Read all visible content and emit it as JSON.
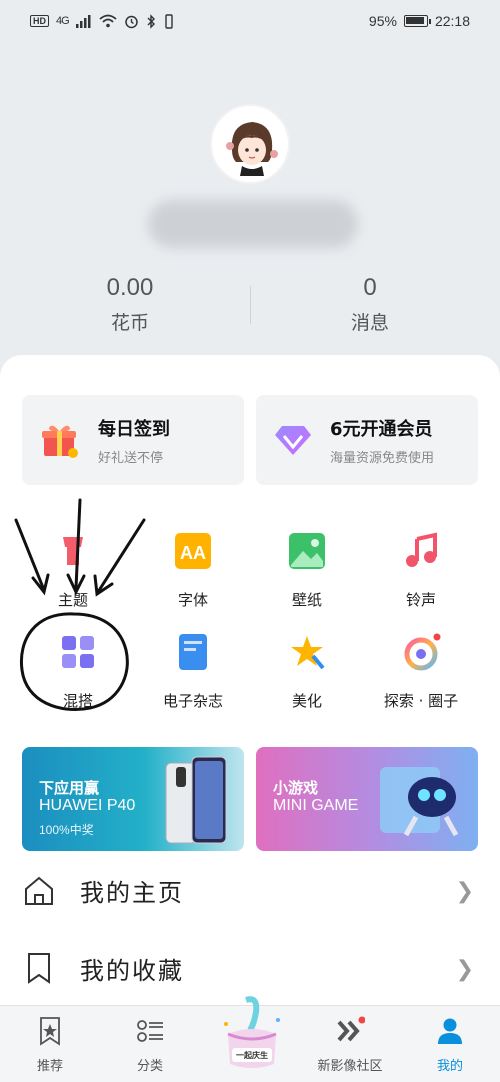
{
  "status_bar": {
    "hd": "HD",
    "network": "4G",
    "battery": "95%",
    "battery_level": 0.95,
    "time": "22:18"
  },
  "profile": {
    "coins_value": "0.00",
    "coins_label": "花币",
    "messages_value": "0",
    "messages_label": "消息"
  },
  "promos": [
    {
      "title": "每日签到",
      "subtitle": "好礼送不停",
      "icon": "gift-icon"
    },
    {
      "title": "6元开通会员",
      "subtitle": "海量资源免费使用",
      "icon": "vip-diamond-icon"
    }
  ],
  "grid": [
    {
      "label": "主题",
      "icon": "theme-icon"
    },
    {
      "label": "字体",
      "icon": "font-icon"
    },
    {
      "label": "壁纸",
      "icon": "wallpaper-icon"
    },
    {
      "label": "铃声",
      "icon": "ringtone-icon"
    },
    {
      "label": "混搭",
      "icon": "mix-icon"
    },
    {
      "label": "电子杂志",
      "icon": "magazine-icon"
    },
    {
      "label": "美化",
      "icon": "beautify-icon"
    },
    {
      "label": "探索 · 圈子",
      "icon": "explore-icon"
    }
  ],
  "banners": [
    {
      "line1": "下应用赢",
      "line2": "HUAWEI P40",
      "line3": "100%中奖"
    },
    {
      "line1": "小游戏",
      "line2": "MINI GAME"
    }
  ],
  "menu": [
    {
      "label": "我的主页",
      "icon": "home-icon"
    },
    {
      "label": "我的收藏",
      "icon": "bookmark-icon"
    }
  ],
  "tabs": [
    {
      "label": "推荐",
      "icon": "recommend-icon"
    },
    {
      "label": "分类",
      "icon": "category-icon"
    },
    {
      "label": "一起庆生",
      "icon": "celebration-icon"
    },
    {
      "label": "新影像社区",
      "icon": "community-icon"
    },
    {
      "label": "我的",
      "icon": "profile-icon"
    }
  ],
  "colors": {
    "accent": "#0a8fdc",
    "background": "#e9edf0",
    "card": "#ffffff",
    "badge_red": "#f04545"
  }
}
